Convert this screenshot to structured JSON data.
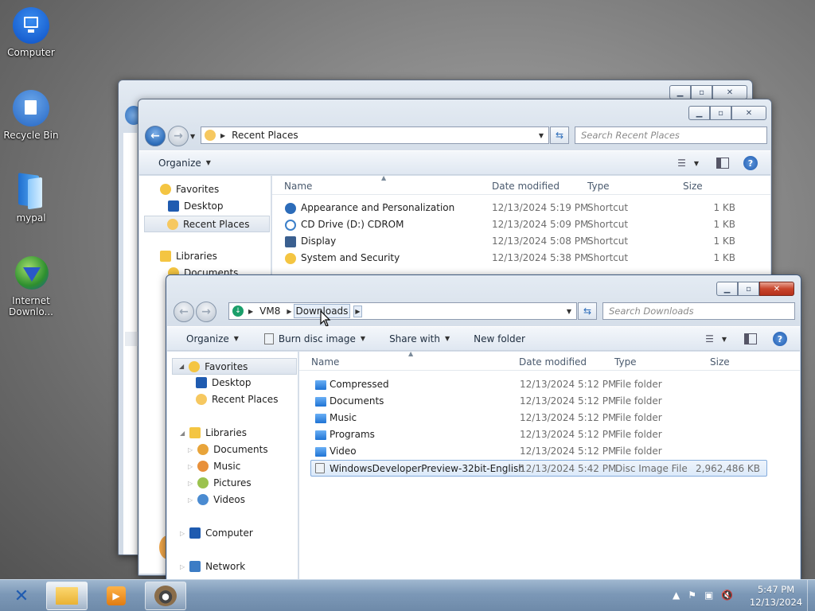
{
  "desktop": {
    "icons": [
      {
        "label": "Computer",
        "icon": "monitor-icon"
      },
      {
        "label": "Recycle Bin",
        "icon": "recycle-bin-icon"
      },
      {
        "label": "mypal",
        "icon": "mypal-icon"
      },
      {
        "label": "Internet Downlo...",
        "label_line1": "Internet",
        "label_line2": "Downlo...",
        "icon": "internet-download-manager-icon"
      }
    ]
  },
  "recent_window": {
    "address": {
      "path": "Recent Places"
    },
    "search_placeholder": "Search Recent Places",
    "toolbar": {
      "organize": "Organize"
    },
    "nav": {
      "favorites": "Favorites",
      "desktop": "Desktop",
      "recent_places": "Recent Places",
      "libraries": "Libraries",
      "documents": "Documents"
    },
    "columns": {
      "name": "Name",
      "date": "Date modified",
      "type": "Type",
      "size": "Size"
    },
    "rows": [
      {
        "name": "Appearance and Personalization",
        "date": "12/13/2024 5:19 PM",
        "type": "Shortcut",
        "size": "1 KB",
        "icon": "control-panel-icon"
      },
      {
        "name": "CD Drive (D:) CDROM",
        "date": "12/13/2024 5:09 PM",
        "type": "Shortcut",
        "size": "1 KB",
        "icon": "cd-drive-icon"
      },
      {
        "name": "Display",
        "date": "12/13/2024 5:08 PM",
        "type": "Shortcut",
        "size": "1 KB",
        "icon": "display-icon"
      },
      {
        "name": "System and Security",
        "date": "12/13/2024 5:38 PM",
        "type": "Shortcut",
        "size": "1 KB",
        "icon": "system-security-icon"
      }
    ]
  },
  "downloads_window": {
    "address": {
      "seg1": "VM8",
      "seg2": "Downloads"
    },
    "search_placeholder": "Search Downloads",
    "toolbar": {
      "organize": "Organize",
      "burn": "Burn disc image",
      "share": "Share with",
      "new_folder": "New folder"
    },
    "nav": {
      "favorites": "Favorites",
      "desktop": "Desktop",
      "recent_places": "Recent Places",
      "libraries": "Libraries",
      "documents": "Documents",
      "music": "Music",
      "pictures": "Pictures",
      "videos": "Videos",
      "computer": "Computer",
      "network": "Network"
    },
    "columns": {
      "name": "Name",
      "date": "Date modified",
      "type": "Type",
      "size": "Size"
    },
    "rows": [
      {
        "name": "Compressed",
        "date": "12/13/2024 5:12 PM",
        "type": "File folder",
        "size": ""
      },
      {
        "name": "Documents",
        "date": "12/13/2024 5:12 PM",
        "type": "File folder",
        "size": ""
      },
      {
        "name": "Music",
        "date": "12/13/2024 5:12 PM",
        "type": "File folder",
        "size": ""
      },
      {
        "name": "Programs",
        "date": "12/13/2024 5:12 PM",
        "type": "File folder",
        "size": ""
      },
      {
        "name": "Video",
        "date": "12/13/2024 5:12 PM",
        "type": "File folder",
        "size": ""
      },
      {
        "name": "WindowsDeveloperPreview-32bit-English",
        "date": "12/13/2024 5:42 PM",
        "type": "Disc Image File",
        "size": "2,962,486 KB"
      }
    ],
    "selected_row": 5
  },
  "taskbar": {
    "clock_time": "5:47 PM",
    "clock_date": "12/13/2024",
    "buttons": [
      "file-explorer-icon",
      "media-player-icon",
      "raccoon-app-icon"
    ]
  },
  "colors": {
    "accent": "#2c6cb9",
    "selection": "#dceafa",
    "close_red": "#c8452c"
  }
}
